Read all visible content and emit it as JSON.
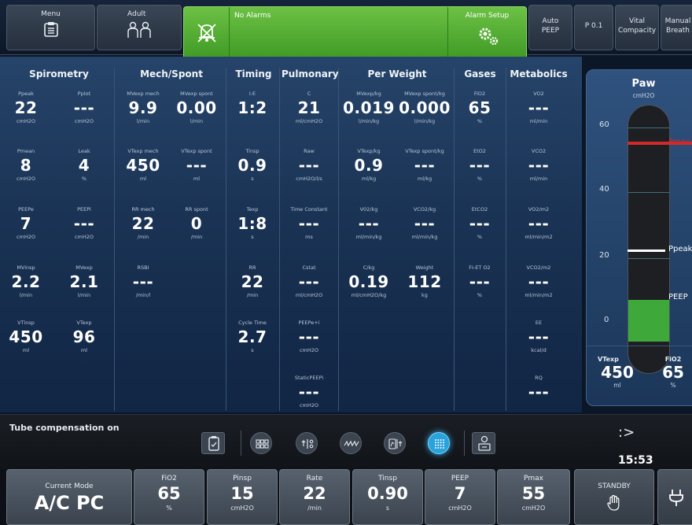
{
  "topbar": {
    "menu": "Menu",
    "patient": "Adult",
    "alarm_status": "No Alarms",
    "alarm_setup": "Alarm Setup",
    "auto_peep": [
      "Auto",
      "PEEP"
    ],
    "p01": "P 0.1",
    "vital_capacity": [
      "Vital",
      "Compacity"
    ],
    "manual_breath": [
      "Manual",
      "Breath"
    ]
  },
  "groups": {
    "spirometry": "Spirometry",
    "mech_spont": "Mech/Spont",
    "timing": "Timing",
    "pulmonary": "Pulmonary",
    "per_weight": "Per Weight",
    "gases": "Gases",
    "metabolics": "Metabolics"
  },
  "cells": {
    "ppeak": {
      "n": "Ppeak",
      "v": "22",
      "u": "cmH2O"
    },
    "pplot": {
      "n": "Pplot",
      "v": "---",
      "u": "cmH2O"
    },
    "pmean": {
      "n": "Pmean",
      "v": "8",
      "u": "cmH2O"
    },
    "leak": {
      "n": "Leak",
      "v": "4",
      "u": "%"
    },
    "peepe": {
      "n": "PEEPe",
      "v": "7",
      "u": "cmH2O"
    },
    "peepi": {
      "n": "PEEPi",
      "v": "---",
      "u": "cmH2O"
    },
    "mvinsp": {
      "n": "MVinsp",
      "v": "2.2",
      "u": "l/min"
    },
    "mvexp": {
      "n": "MVexp",
      "v": "2.1",
      "u": "l/min"
    },
    "vtinsp": {
      "n": "VTinsp",
      "v": "450",
      "u": "ml"
    },
    "vtexp": {
      "n": "VTexp",
      "v": "96",
      "u": "ml"
    },
    "mvexp_mech": {
      "n": "MVexp mech",
      "v": "9.9",
      "u": "l/min"
    },
    "mvexp_spont": {
      "n": "MVexp spont",
      "v": "0.00",
      "u": "l/min"
    },
    "vtexp_mech": {
      "n": "VTexp mech",
      "v": "450",
      "u": "ml"
    },
    "vtexp_spont": {
      "n": "VTexp spont",
      "v": "---",
      "u": "ml"
    },
    "rr_mech": {
      "n": "RR mech",
      "v": "22",
      "u": "/min"
    },
    "rr_spont": {
      "n": "RR spont",
      "v": "0",
      "u": "/min"
    },
    "rsbi": {
      "n": "RSBI",
      "v": "---",
      "u": "/min/l"
    },
    "ie": {
      "n": "I:E",
      "v": "1:2",
      "u": ""
    },
    "tinsp": {
      "n": "Tinsp",
      "v": "0.9",
      "u": "s"
    },
    "texp": {
      "n": "Texp",
      "v": "1:8",
      "u": "s"
    },
    "rr": {
      "n": "RR",
      "v": "22",
      "u": "/min"
    },
    "cycle_time": {
      "n": "Cycle Time",
      "v": "2.7",
      "u": "s"
    },
    "c": {
      "n": "C",
      "v": "21",
      "u": "ml/cmH2O"
    },
    "raw": {
      "n": "Raw",
      "v": "---",
      "u": "cmH2O/l/s"
    },
    "time_constant": {
      "n": "Time Constant",
      "v": "---",
      "u": "ms"
    },
    "cstat": {
      "n": "Cstat",
      "v": "---",
      "u": "ml/cmH2O"
    },
    "peepe_i": {
      "n": "PEEPe+i",
      "v": "---",
      "u": "cmH2O"
    },
    "static_peepi": {
      "n": "StaticPEEPi",
      "v": "---",
      "u": "cmH2O"
    },
    "mvexp_kg": {
      "n": "MVexp/kg",
      "v": "0.019",
      "u": "l/min/kg"
    },
    "mvexp_spont_kg": {
      "n": "MVexp spont/kg",
      "v": "0.000",
      "u": "l/min/kg"
    },
    "vtexp_kg": {
      "n": "VTexp/kg",
      "v": "0.9",
      "u": "ml/kg"
    },
    "vtexp_spont_kg": {
      "n": "VTexp spont/kg",
      "v": "---",
      "u": "ml/kg"
    },
    "vo2_kg": {
      "n": "V02/kg",
      "v": "---",
      "u": "ml/min/kg"
    },
    "vco2_kg": {
      "n": "VCO2/kg",
      "v": "---",
      "u": "ml/min/kg"
    },
    "c_kg": {
      "n": "C/kg",
      "v": "0.19",
      "u": "ml/cmH2O/kg"
    },
    "weight": {
      "n": "Weight",
      "v": "112",
      "u": "kg"
    },
    "fio2": {
      "n": "FiO2",
      "v": "65",
      "u": "%"
    },
    "eto2": {
      "n": "EtO2",
      "v": "---",
      "u": "%"
    },
    "etco2": {
      "n": "EtCO2",
      "v": "---",
      "u": "%"
    },
    "fi_et_o2": {
      "n": "FI-ET O2",
      "v": "---",
      "u": "%"
    },
    "vo2": {
      "n": "VO2",
      "v": "---",
      "u": "ml/min"
    },
    "vco2": {
      "n": "VCO2",
      "v": "---",
      "u": "ml/min"
    },
    "vo2_m2": {
      "n": "VO2/m2",
      "v": "---",
      "u": "ml/min/m2"
    },
    "vco2_m2": {
      "n": "VCO2/m2",
      "v": "---",
      "u": "ml/min/m2"
    },
    "ee": {
      "n": "EE",
      "v": "---",
      "u": "kcal/d"
    },
    "rq": {
      "n": "RQ",
      "v": "---",
      "u": ""
    }
  },
  "paw": {
    "title": "Paw",
    "unit": "cmH2O",
    "ticks": [
      "60",
      "40",
      "20",
      "0"
    ],
    "pmax_label": "Pmax",
    "ppeak_label": "Ppeak",
    "peep_label": "PEEP",
    "pmax_value": 55,
    "ppeak_value": 22,
    "peep_value": 7,
    "scale_min": 0,
    "scale_max": 60,
    "vtexp": {
      "n": "VTexp",
      "v": "450",
      "u": "ml"
    },
    "fio2": {
      "n": "FiO2",
      "v": "65",
      "u": "%"
    }
  },
  "toolbar": {
    "tube_compensation": "Tube compensation on",
    "time": "15:53"
  },
  "settings": {
    "mode": {
      "n": "Current Mode",
      "v": "A/C PC"
    },
    "fio2": {
      "n": "FiO2",
      "v": "65",
      "u": "%"
    },
    "pinsp": {
      "n": "Pinsp",
      "v": "15",
      "u": "cmH2O"
    },
    "rate": {
      "n": "Rate",
      "v": "22",
      "u": "/min"
    },
    "tinsp": {
      "n": "Tinsp",
      "v": "0.90",
      "u": "s"
    },
    "peep": {
      "n": "PEEP",
      "v": "7",
      "u": "cmH2O"
    },
    "pmax": {
      "n": "Pmax",
      "v": "55",
      "u": "cmH2O"
    },
    "standby": "STANDBY"
  },
  "colors": {
    "alarm_green": "#4caf33",
    "pmax_red": "#d22a2a",
    "peep_green": "#3fa83a",
    "active_blue": "#2aa3dc"
  }
}
